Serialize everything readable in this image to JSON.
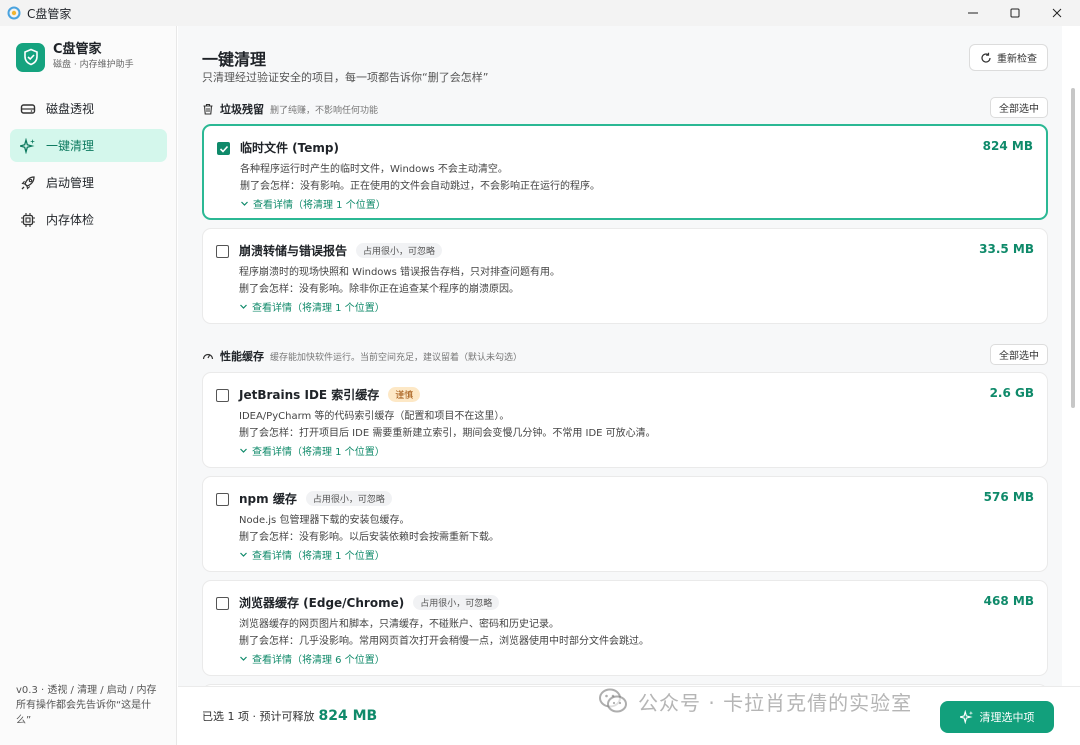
{
  "window": {
    "title": "C盘管家"
  },
  "sidebar": {
    "brand_name": "C盘管家",
    "brand_sub": "磁盘 · 内存维护助手",
    "items": [
      {
        "label": "磁盘透视",
        "icon": "drive-icon",
        "active": false
      },
      {
        "label": "一键清理",
        "icon": "sparkle-icon",
        "active": true
      },
      {
        "label": "启动管理",
        "icon": "rocket-icon",
        "active": false
      },
      {
        "label": "内存体检",
        "icon": "chip-icon",
        "active": false
      }
    ],
    "footer_line1": "v0.3 · 透视 / 清理 / 启动 / 内存",
    "footer_line2": "所有操作都会先告诉你“这是什",
    "footer_line3": "么”"
  },
  "main": {
    "title": "一键清理",
    "subtitle": "只清理经过验证安全的项目，每一项都告诉你“删了会怎样”",
    "recheck_label": "重新检查",
    "sections": [
      {
        "title": "垃圾残留",
        "note": "删了纯赚，不影响任何功能",
        "select_all": "全部选中",
        "icon": "trash-icon",
        "items": [
          {
            "name": "临时文件 (Temp)",
            "tag": "",
            "size": "824 MB",
            "checked": true,
            "desc": "各种程序运行时产生的临时文件，Windows 不会主动清空。",
            "effect": "删了会怎样：没有影响。正在使用的文件会自动跳过，不会影响正在运行的程序。",
            "detail": "查看详情（将清理 1 个位置）"
          },
          {
            "name": "崩溃转储与错误报告",
            "tag": "占用很小，可忽略",
            "size": "33.5 MB",
            "checked": false,
            "desc": "程序崩溃时的现场快照和 Windows 错误报告存档，只对排查问题有用。",
            "effect": "删了会怎样：没有影响。除非你正在追查某个程序的崩溃原因。",
            "detail": "查看详情（将清理 1 个位置）"
          }
        ]
      },
      {
        "title": "性能缓存",
        "note": "缓存能加快软件运行。当前空间充足，建议留着（默认未勾选）",
        "select_all": "全部选中",
        "icon": "gauge-icon",
        "items": [
          {
            "name": "JetBrains IDE 索引缓存",
            "tag": "谨慎",
            "tag_warn": true,
            "size": "2.6 GB",
            "checked": false,
            "desc": "IDEA/PyCharm 等的代码索引缓存（配置和项目不在这里）。",
            "effect": "删了会怎样：打开项目后 IDE 需要重新建立索引，期间会变慢几分钟。不常用 IDE 可放心清。",
            "detail": "查看详情（将清理 1 个位置）"
          },
          {
            "name": "npm 缓存",
            "tag": "占用很小，可忽略",
            "size": "576 MB",
            "checked": false,
            "desc": "Node.js 包管理器下载的安装包缓存。",
            "effect": "删了会怎样：没有影响。以后安装依赖时会按需重新下载。",
            "detail": "查看详情（将清理 1 个位置）"
          },
          {
            "name": "浏览器缓存 (Edge/Chrome)",
            "tag": "占用很小，可忽略",
            "size": "468 MB",
            "checked": false,
            "desc": "浏览器缓存的网页图片和脚本，只清缓存，不碰账户、密码和历史记录。",
            "effect": "删了会怎样：几乎没影响。常用网页首次打开会稍慢一点，浏览器使用中时部分文件会跳过。",
            "detail": "查看详情（将清理 6 个位置）"
          }
        ]
      }
    ]
  },
  "bottom": {
    "selected_label": "已选 1 项 · 预计可释放",
    "selected_size": "824 MB",
    "clean_label": "清理选中项"
  },
  "watermark": {
    "text": "公众号 · 卡拉肖克倩的实验室"
  },
  "colors": {
    "accent": "#12a07c",
    "accent_text": "#0f8a6a",
    "active_bg": "#d4f7ec",
    "warn_bg": "#fde8c6"
  }
}
